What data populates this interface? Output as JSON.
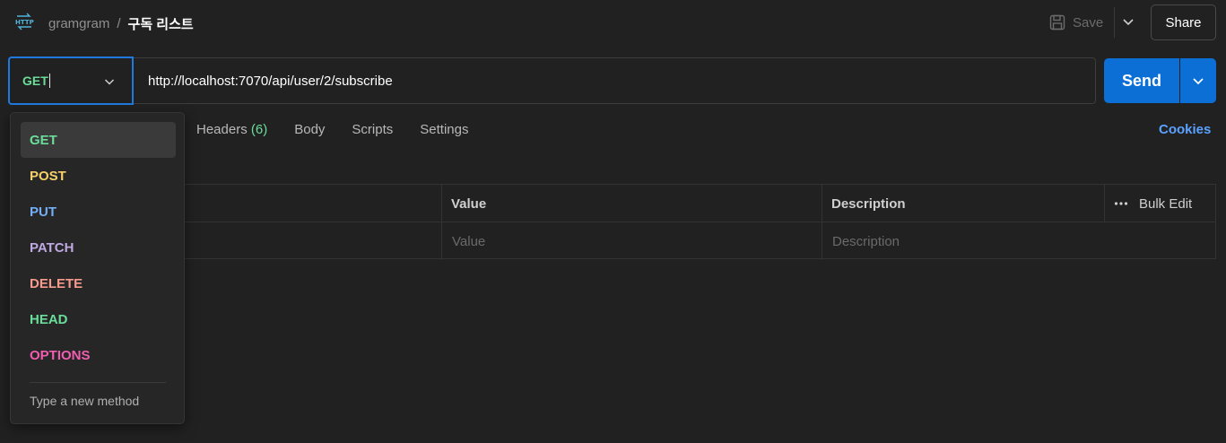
{
  "breadcrumb": {
    "collection": "gramgram",
    "separator": "/",
    "request_title": "구독 리스트"
  },
  "header": {
    "save_label": "Save",
    "share_label": "Share"
  },
  "request": {
    "method": "GET",
    "url": "http://localhost:7070/api/user/2/subscribe",
    "send_label": "Send"
  },
  "tabs": [
    {
      "label": "Headers",
      "count": "(6)"
    },
    {
      "label": "Body"
    },
    {
      "label": "Scripts"
    },
    {
      "label": "Settings"
    }
  ],
  "cookies_label": "Cookies",
  "table": {
    "headers": {
      "value": "Value",
      "description": "Description",
      "bulk_edit": "Bulk Edit"
    },
    "placeholders": {
      "value": "Value",
      "description": "Description"
    }
  },
  "method_dropdown": {
    "items": [
      {
        "label": "GET",
        "color": "#6bdd9a",
        "active": true
      },
      {
        "label": "POST",
        "color": "#f7d06b"
      },
      {
        "label": "PUT",
        "color": "#74aef6"
      },
      {
        "label": "PATCH",
        "color": "#c0a8e1"
      },
      {
        "label": "DELETE",
        "color": "#f79a8e"
      },
      {
        "label": "HEAD",
        "color": "#6bdd9a"
      },
      {
        "label": "OPTIONS",
        "color": "#f15eb0"
      }
    ],
    "new_method_label": "Type a new method"
  },
  "colors": {
    "accent": "#0c6fd6",
    "focus_border": "#1f7ae0",
    "link": "#5aa2ff"
  }
}
